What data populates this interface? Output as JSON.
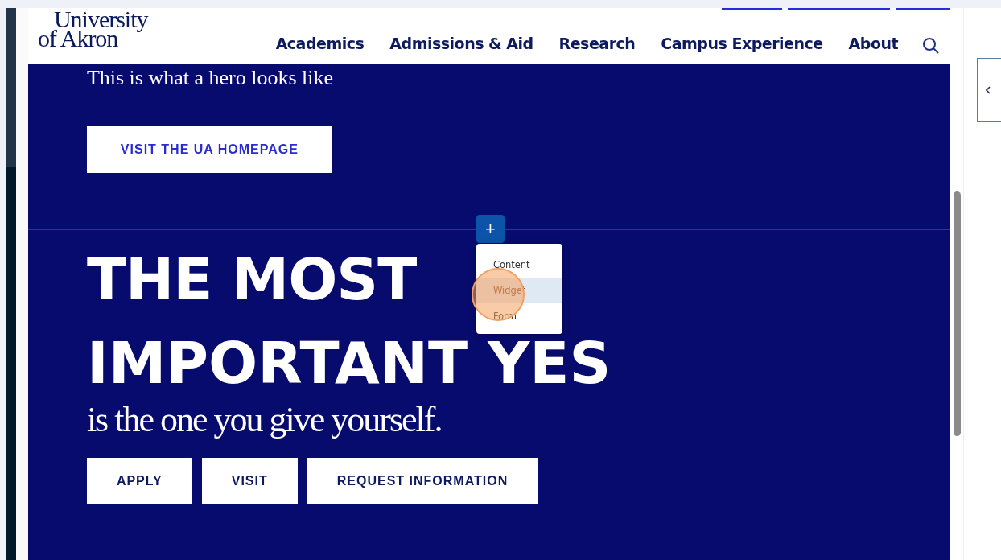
{
  "header": {
    "logo": [
      "University",
      "of Akron"
    ],
    "nav": [
      {
        "label": "Academics"
      },
      {
        "label": "Admissions & Aid"
      },
      {
        "label": "Research"
      },
      {
        "label": "Campus Experience"
      },
      {
        "label": "About"
      }
    ]
  },
  "hero": {
    "tagline": "This is what a hero looks like",
    "button": "VISIT THE UA HOMEPAGE"
  },
  "add_block": {
    "button": "+",
    "menu": [
      {
        "label": "Content",
        "selected": false
      },
      {
        "label": "Widget",
        "selected": true
      },
      {
        "label": "Form",
        "selected": false
      }
    ]
  },
  "section": {
    "headline": [
      "THE MOST",
      "IMPORTANT YES"
    ],
    "subhead": "is the one you give yourself.",
    "buttons": [
      "APPLY",
      "VISIT",
      "REQUEST INFORMATION"
    ]
  }
}
